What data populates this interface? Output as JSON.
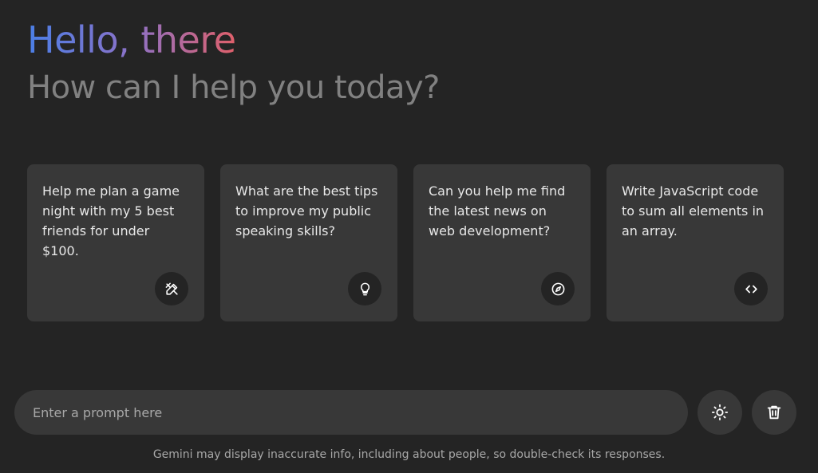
{
  "header": {
    "greeting": "Hello, there",
    "subtitle": "How can I help you today?"
  },
  "suggestions": [
    {
      "text": "Help me plan a game night with my 5 best friends for under $100.",
      "icon": "draw-icon"
    },
    {
      "text": "What are the best tips to improve my public speaking skills?",
      "icon": "lightbulb-icon"
    },
    {
      "text": "Can you help me find the latest news on web development?",
      "icon": "compass-icon"
    },
    {
      "text": "Write JavaScript code to sum all elements in an array.",
      "icon": "code-icon"
    }
  ],
  "input": {
    "placeholder": "Enter a prompt here",
    "theme_button_icon": "sun-icon",
    "delete_button_icon": "trash-icon"
  },
  "footer": {
    "disclaimer": "Gemini may display inaccurate info, including about people, so double-check its responses."
  },
  "colors": {
    "background": "#242424",
    "surface": "#383838",
    "greeting_gradient_start": "#4b7fe6",
    "greeting_gradient_end": "#e0606a",
    "subtitle": "#818181"
  }
}
